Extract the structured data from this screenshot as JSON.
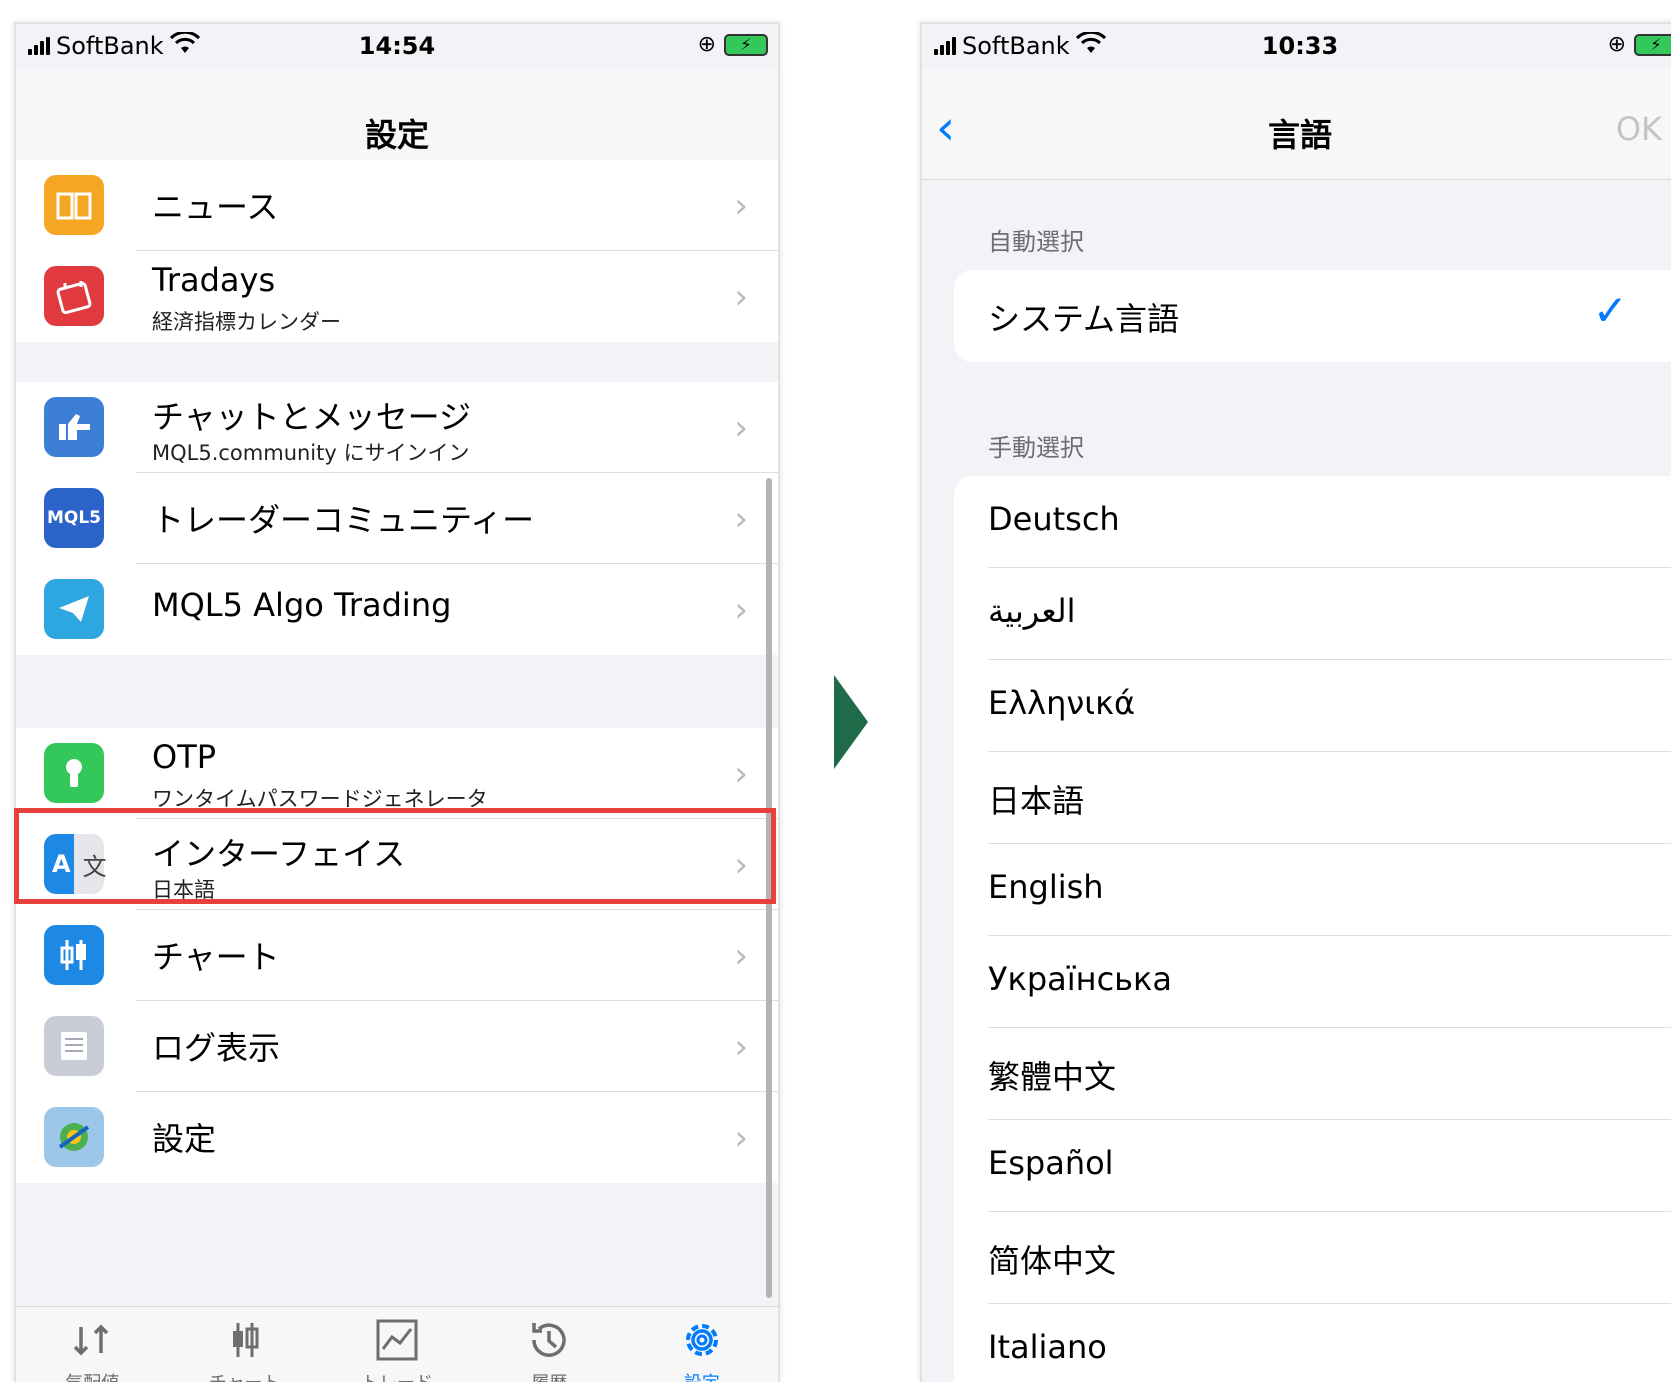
{
  "left_screen": {
    "status": {
      "carrier": "SoftBank",
      "time": "14:54"
    },
    "title": "設定",
    "groups": [
      {
        "items": [
          {
            "label": "ニュース",
            "sub": "",
            "icon": "book-icon",
            "color": "#f5a623"
          },
          {
            "label": "Tradays",
            "sub": "経済指標カレンダー",
            "icon": "calendar-icon",
            "color": "#e03a3e"
          }
        ]
      },
      {
        "items": [
          {
            "label": "チャットとメッセージ",
            "sub": "MQL5.community にサインイン",
            "icon": "thumbs-up-icon",
            "color": "#3d7fd6"
          },
          {
            "label": "トレーダーコミュニティー",
            "sub": "",
            "icon": "mql5-icon",
            "color": "#2c63c9",
            "icon_text": "MQL5"
          },
          {
            "label": "MQL5 Algo Trading",
            "sub": "",
            "icon": "telegram-icon",
            "color": "#2ea7e0"
          }
        ]
      },
      {
        "items": [
          {
            "label": "OTP",
            "sub": "ワンタイムパスワードジェネレータ",
            "icon": "keyhole-icon",
            "color": "#34c759"
          },
          {
            "label": "インターフェイス",
            "sub": "日本語",
            "icon": "translate-icon",
            "color": "#1e88e5",
            "icon_text": "A"
          },
          {
            "label": "チャート",
            "sub": "",
            "icon": "candlestick-icon",
            "color": "#1e88e5"
          },
          {
            "label": "ログ表示",
            "sub": "",
            "icon": "document-icon",
            "color": "#c9ced6"
          },
          {
            "label": "設定",
            "sub": "",
            "icon": "metatrader-icon",
            "color": "#9cc7e8"
          }
        ]
      }
    ],
    "tabs": [
      {
        "label": "気配値",
        "icon": "quotes-icon"
      },
      {
        "label": "チャート",
        "icon": "chart-icon"
      },
      {
        "label": "トレード",
        "icon": "trade-icon"
      },
      {
        "label": "履歴",
        "icon": "history-icon"
      },
      {
        "label": "設定",
        "icon": "gear-icon",
        "active": true
      }
    ]
  },
  "right_screen": {
    "status": {
      "carrier": "SoftBank",
      "time": "10:33"
    },
    "title": "言語",
    "ok_label": "OK",
    "auto_header": "自動選択",
    "system_language": "システム言語",
    "manual_header": "手動選択",
    "languages": [
      "Deutsch",
      "العربية",
      "Ελληνικά",
      "日本語",
      "English",
      "Українська",
      "繁體中文",
      "Español",
      "简体中文",
      "Italiano"
    ]
  },
  "colors": {
    "accent": "#007aff",
    "highlight": "#e8413b",
    "arrow": "#1f6b49"
  }
}
